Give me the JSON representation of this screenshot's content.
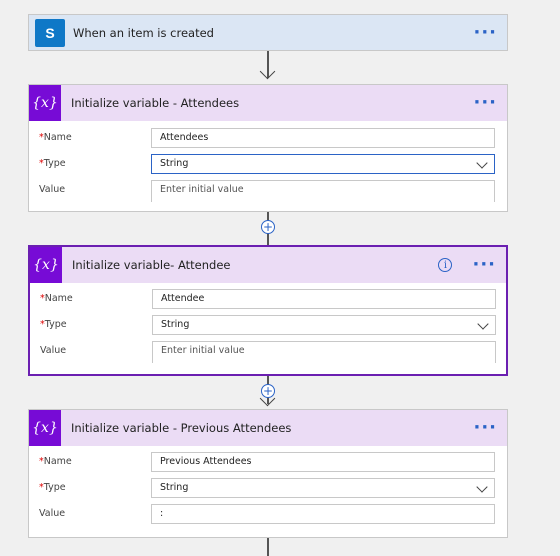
{
  "trigger": {
    "title": "When an item is created",
    "icon": "sharepoint-icon",
    "icon_letter": "S",
    "more": "···"
  },
  "var_icon_glyph": "{x}",
  "actions": [
    {
      "title": "Initialize variable - Attendees",
      "name_label": "*Name",
      "name_value": "Attendees",
      "type_label": "*Type",
      "type_value": "String",
      "value_label": "Value",
      "value_placeholder": "Enter initial value",
      "more": "···"
    },
    {
      "title": "Initialize variable- Attendee",
      "name_label": "*Name",
      "name_value": "Attendee",
      "type_label": "*Type",
      "type_value": "String",
      "value_label": "Value",
      "value_placeholder": "Enter initial value",
      "info_glyph": "i",
      "more": "···"
    },
    {
      "title": "Initialize variable - Previous Attendees",
      "name_label": "*Name",
      "name_value": "Previous Attendees",
      "type_label": "*Type",
      "type_value": "String",
      "value_label": "Value",
      "value_value": ":",
      "more": "···"
    }
  ],
  "plus_glyph": "+"
}
